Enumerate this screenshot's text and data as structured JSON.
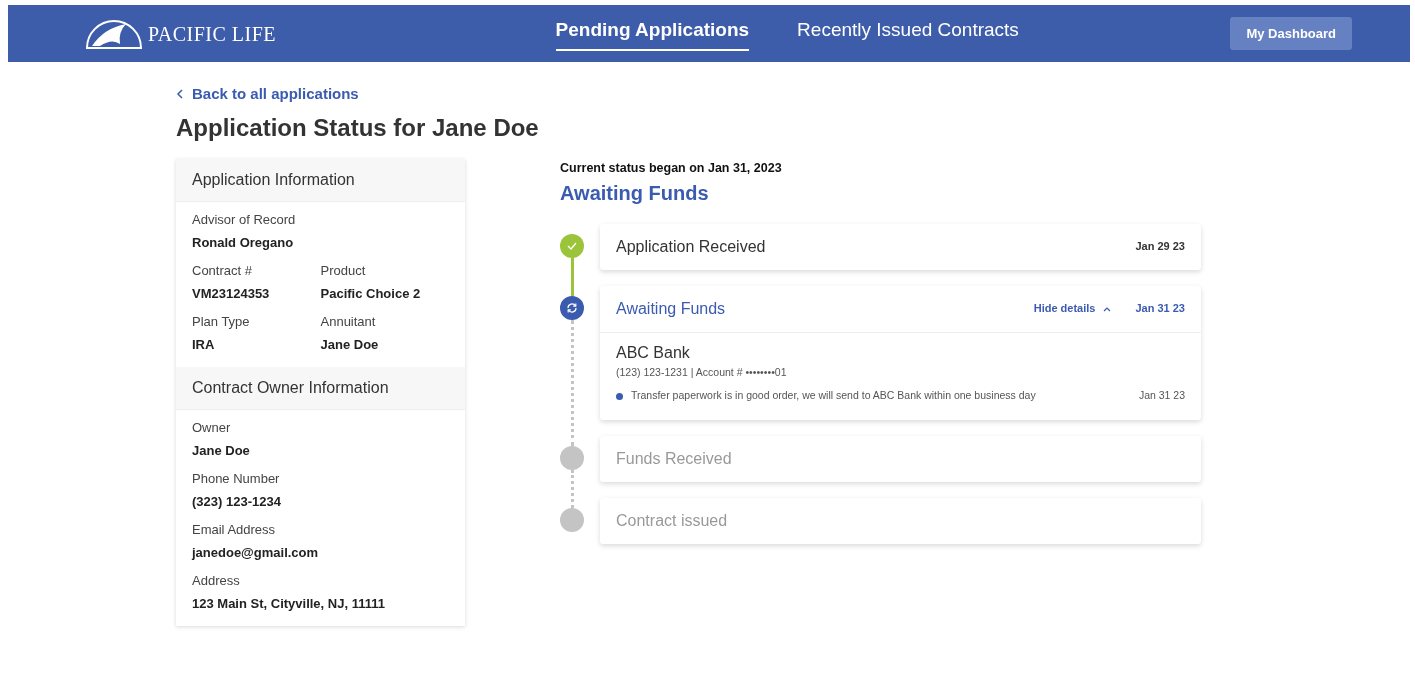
{
  "brand": {
    "name": "PACIFIC LIFE"
  },
  "nav": {
    "tabs": [
      {
        "label": "Pending Applications",
        "selected": true
      },
      {
        "label": "Recently Issued Contracts",
        "selected": false
      }
    ],
    "button": "My Dashboard"
  },
  "back_link": "Back to all applications",
  "page_title": "Application Status for Jane Doe",
  "info_sections": [
    {
      "title": "Application Information",
      "rows": [
        [
          {
            "label": "Advisor of Record",
            "value": "Ronald Oregano"
          }
        ],
        [
          {
            "label": "Contract #",
            "value": "VM23124353"
          },
          {
            "label": "Product",
            "value": "Pacific Choice 2"
          }
        ],
        [
          {
            "label": "Plan Type",
            "value": "IRA"
          },
          {
            "label": "Annuitant",
            "value": "Jane Doe"
          }
        ]
      ]
    },
    {
      "title": "Contract Owner Information",
      "rows": [
        [
          {
            "label": "Owner",
            "value": "Jane Doe"
          }
        ],
        [
          {
            "label": "Phone Number",
            "value": "(323) 123-1234"
          }
        ],
        [
          {
            "label": "Email Address",
            "value": "janedoe@gmail.com"
          }
        ],
        [
          {
            "label": "Address",
            "value": "123 Main St, Cityville, NJ, 11111"
          }
        ]
      ]
    }
  ],
  "status": {
    "began": "Current status began on Jan 31, 2023",
    "current": "Awaiting Funds"
  },
  "steps": [
    {
      "title": "Application Received",
      "completed": true,
      "active": false,
      "date": "Jan 29 23"
    },
    {
      "title": "Awaiting Funds",
      "completed": false,
      "active": true,
      "date": "Jan 31 23",
      "toggle": "Hide details",
      "expanded": true,
      "details": {
        "bank": "ABC Bank",
        "contact": "(123) 123-1231 | Account # ••••••••01",
        "events": [
          {
            "text": "Transfer paperwork is in good order, we will send to ABC Bank within one business day",
            "date": "Jan 31 23",
            "color": "#3b5bb0"
          }
        ]
      }
    },
    {
      "title": "Funds Received",
      "completed": false,
      "active": false
    },
    {
      "title": "Contract issued",
      "completed": false,
      "active": false
    }
  ]
}
